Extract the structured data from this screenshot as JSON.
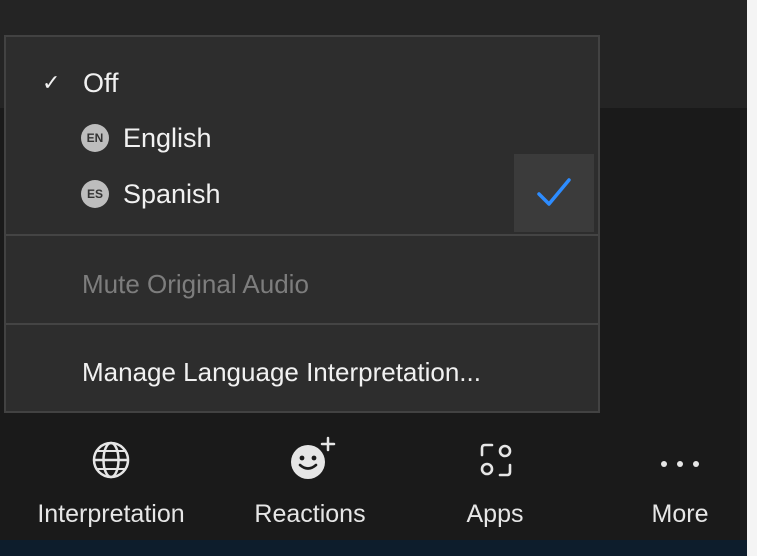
{
  "menu": {
    "items": [
      {
        "label": "Off",
        "checked": true
      },
      {
        "label": "English",
        "badge": "EN"
      },
      {
        "label": "Spanish",
        "badge": "ES"
      }
    ],
    "mute_original_audio": "Mute Original Audio",
    "manage": "Manage Language Interpretation..."
  },
  "toolbar": {
    "buttons": [
      {
        "label": "Interpretation",
        "icon": "globe-icon"
      },
      {
        "label": "Reactions",
        "icon": "emoji-add-icon"
      },
      {
        "label": "Apps",
        "icon": "apps-icon"
      },
      {
        "label": "More",
        "icon": "ellipsis-icon"
      }
    ]
  },
  "colors": {
    "accent_check": "#2d8cff",
    "menu_bg": "#2d2d2d",
    "disabled_text": "#7d7d7d"
  }
}
